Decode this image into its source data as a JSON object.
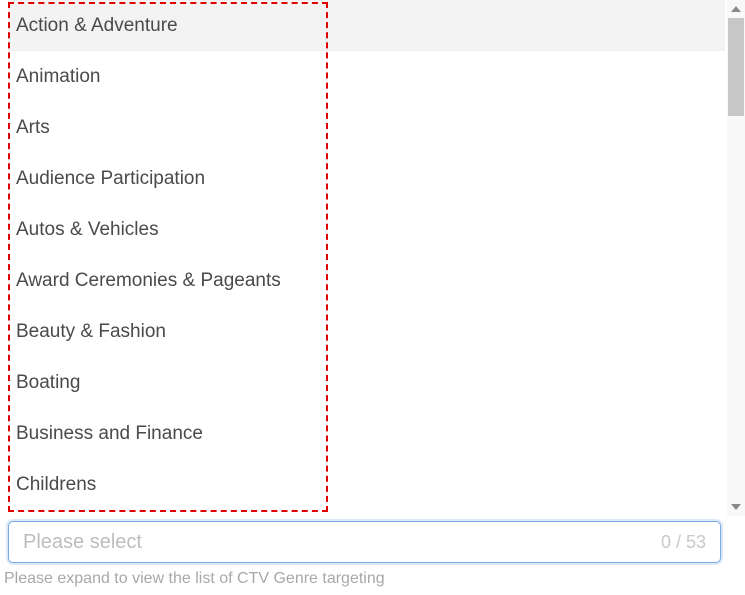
{
  "options": [
    "Action & Adventure",
    "Animation",
    "Arts",
    "Audience Participation",
    "Autos & Vehicles",
    "Award Ceremonies & Pageants",
    "Beauty & Fashion",
    "Boating",
    "Business and Finance",
    "Childrens"
  ],
  "hovered_index": 0,
  "select": {
    "placeholder": "Please select",
    "value": "",
    "counter": "0 / 53"
  },
  "helper_text": "Please expand to view the list of CTV Genre targeting"
}
